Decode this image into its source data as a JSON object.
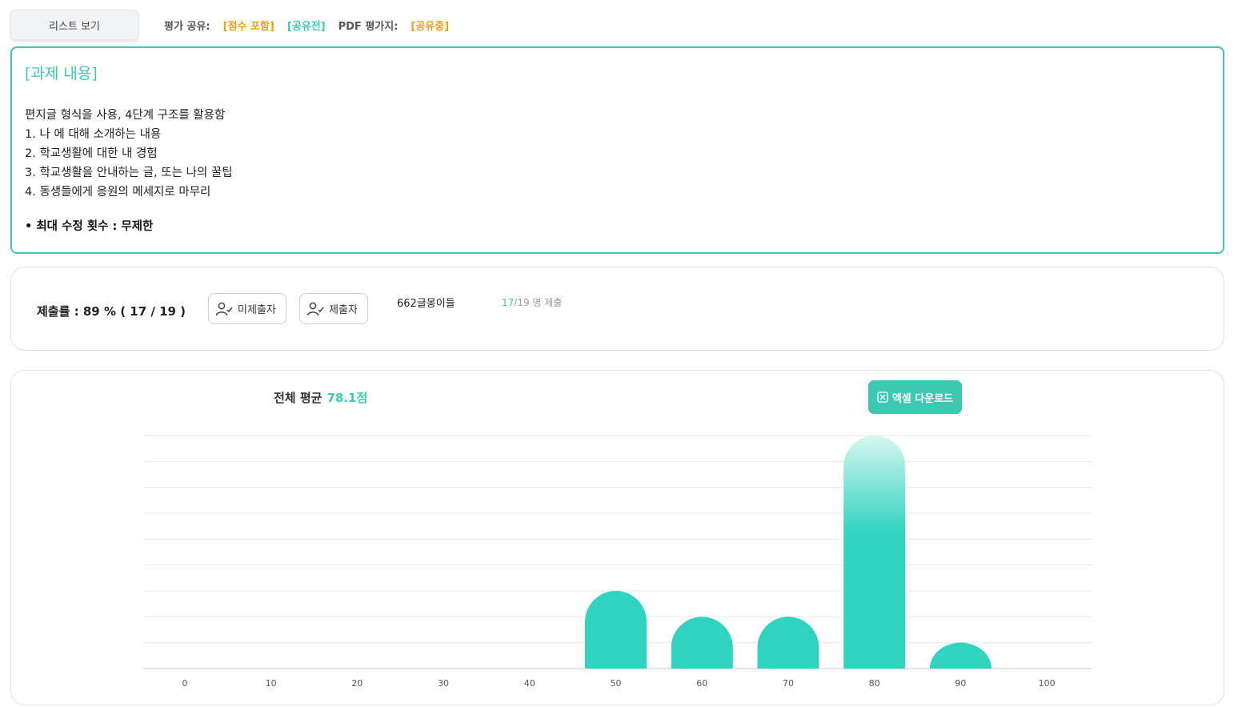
{
  "toolbar": {
    "list_button": "리스트 보기",
    "share_label": "평가 공유:",
    "score_included": "[점수 포함]",
    "share_status": "[공유전]",
    "pdf_label": "PDF 평가지:",
    "pdf_status": "[공유중]"
  },
  "task": {
    "title": "[과제 내용]",
    "lines": [
      "편지글 형식을 사용, 4단계 구조를 활용함",
      "1. 나 에 대해 소개하는 내용",
      "2. 학교생활에 대한 내 경험",
      "3. 학교생활을 안내하는 글, 또는 나의 꿀팁",
      "4. 동생들에게 응원의 메세지로 마무리"
    ],
    "limit": "• 최대 수정 횟수 : 무제한"
  },
  "submission": {
    "rate_text": "제출률 : 89 % ( 17 / 19 )",
    "not_submitted_button": "미제출자",
    "submitted_button": "제출자",
    "group_name": "662글몽이들",
    "submitted_count": "17",
    "count_suffix": "/19 명 제출"
  },
  "summary": {
    "avg_label": "전체 평균",
    "avg_value": "78.1점",
    "excel_button": "엑셀 다운로드"
  },
  "colors": {
    "accent": "#3cc9b4",
    "bar": "#2fd3bf",
    "orange": "#f39c12"
  },
  "chart_data": {
    "type": "bar",
    "categories": [
      "0",
      "10",
      "20",
      "30",
      "40",
      "50",
      "60",
      "70",
      "80",
      "90",
      "100"
    ],
    "values": [
      0,
      0,
      0,
      0,
      0,
      3,
      2,
      2,
      9,
      1,
      0
    ],
    "ylim": [
      0,
      9
    ],
    "grid": true,
    "highlight_category": "80"
  }
}
